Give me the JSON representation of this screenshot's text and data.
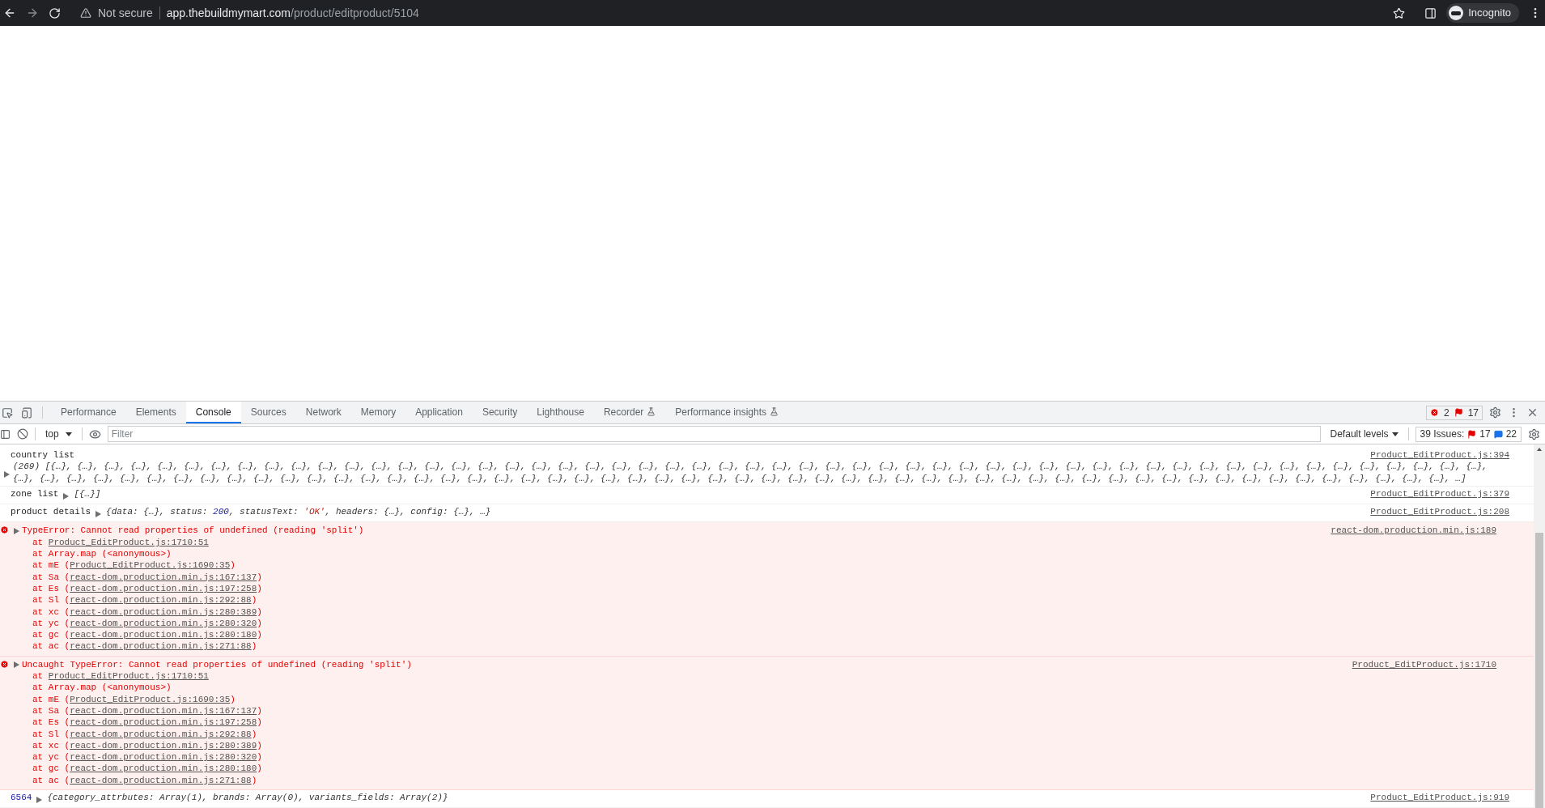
{
  "browser": {
    "security": "Not secure",
    "url_host": "app.thebuildmymart.com",
    "url_path": "/product/editproduct/5104",
    "profile": "Incognito"
  },
  "devtools": {
    "tabs": [
      {
        "label": "Performance",
        "selected": false,
        "experimental": false
      },
      {
        "label": "Elements",
        "selected": false,
        "experimental": false
      },
      {
        "label": "Console",
        "selected": true,
        "experimental": false
      },
      {
        "label": "Sources",
        "selected": false,
        "experimental": false
      },
      {
        "label": "Network",
        "selected": false,
        "experimental": false
      },
      {
        "label": "Memory",
        "selected": false,
        "experimental": false
      },
      {
        "label": "Application",
        "selected": false,
        "experimental": false
      },
      {
        "label": "Security",
        "selected": false,
        "experimental": false
      },
      {
        "label": "Lighthouse",
        "selected": false,
        "experimental": false
      },
      {
        "label": "Recorder",
        "selected": false,
        "experimental": true
      },
      {
        "label": "Performance insights",
        "selected": false,
        "experimental": true
      }
    ],
    "error_count": "2",
    "issue_count": "17",
    "context": "top",
    "filter_placeholder": "Filter",
    "levels": "Default levels",
    "issues": {
      "label": "39 Issues:",
      "errors": "17",
      "info": "22"
    }
  },
  "messages": [
    {
      "kind": "log",
      "label": "country list",
      "count": "(269)",
      "preview": [
        {
          "text": "[{…}, {…}, {…}, {…}, {…}, {…}, {…}, {…}, {…}, {…}, {…}, {…}, {…}, {…}, {…}, {…}, {…}, {…}, {…}, {…}, {…}, {…}, {…}, {…}, {…}, {…}, {…}, {…}, {…}, {…}, {…}, {…}, {…}, {…}, {…}, {…}, {…}, {…}, {…}, {…}, {…}, {…}, {…}, {…}, {…}, {…}, {…}, {…}, {…}, {…}, {…}, {…}, {…}, {…}, {…}, {…}, {…}, {…}, {…}, {…}, {…}, {…}, {…}, {…}, {…}, {…}, {…}, {…}, {…}, {…}, {…}, {…}, {…}, {…}, {…}, {…}, {…}, {…}, {…}, {…}, {…}, {…}, {…}, {…}, {…}, {…}, {…}, {…}, {…}, {…}, {…}, {…}, {…}, {…}, {…}, {…}, {…}, {…}, {…}, {…}, {…}, {…}, {…}, {…}, {…}, {…}, {…}, {…}, …]",
          "kind": "plain"
        }
      ],
      "source": "Product_EditProduct.js:394"
    },
    {
      "kind": "log",
      "label": "zone list",
      "preview": [
        {
          "text": "[{…}]",
          "kind": "plain"
        }
      ],
      "source": "Product_EditProduct.js:379"
    },
    {
      "kind": "log",
      "label": "product details",
      "preview": [
        {
          "text": "{data: {…}, status: ",
          "kind": "plain"
        },
        {
          "text": "200",
          "kind": "number"
        },
        {
          "text": ", statusText: ",
          "kind": "plain"
        },
        {
          "text": "'OK'",
          "kind": "string"
        },
        {
          "text": ", headers: {…}, config: {…}, …}",
          "kind": "plain"
        }
      ],
      "source": "Product_EditProduct.js:208"
    },
    {
      "kind": "error",
      "label": "TypeError: Cannot read properties of undefined (reading 'split')",
      "source": "react-dom.production.min.js:189",
      "stack": [
        [
          {
            "text": "at "
          },
          {
            "text": "Product_EditProduct.js:1710:51",
            "link": true
          }
        ],
        [
          {
            "text": "at Array.map (<anonymous>)"
          }
        ],
        [
          {
            "text": "at mE ("
          },
          {
            "text": "Product_EditProduct.js:1690:35",
            "link": true
          },
          {
            "text": ")"
          }
        ],
        [
          {
            "text": "at Sa ("
          },
          {
            "text": "react-dom.production.min.js:167:137",
            "link": true
          },
          {
            "text": ")"
          }
        ],
        [
          {
            "text": "at Es ("
          },
          {
            "text": "react-dom.production.min.js:197:258",
            "link": true
          },
          {
            "text": ")"
          }
        ],
        [
          {
            "text": "at Sl ("
          },
          {
            "text": "react-dom.production.min.js:292:88",
            "link": true
          },
          {
            "text": ")"
          }
        ],
        [
          {
            "text": "at xc ("
          },
          {
            "text": "react-dom.production.min.js:280:389",
            "link": true
          },
          {
            "text": ")"
          }
        ],
        [
          {
            "text": "at yc ("
          },
          {
            "text": "react-dom.production.min.js:280:320",
            "link": true
          },
          {
            "text": ")"
          }
        ],
        [
          {
            "text": "at gc ("
          },
          {
            "text": "react-dom.production.min.js:280:180",
            "link": true
          },
          {
            "text": ")"
          }
        ],
        [
          {
            "text": "at ac ("
          },
          {
            "text": "react-dom.production.min.js:271:88",
            "link": true
          },
          {
            "text": ")"
          }
        ]
      ]
    },
    {
      "kind": "error",
      "label": "Uncaught TypeError: Cannot read properties of undefined (reading 'split')",
      "source": "Product_EditProduct.js:1710",
      "stack": [
        [
          {
            "text": "at "
          },
          {
            "text": "Product_EditProduct.js:1710:51",
            "link": true
          }
        ],
        [
          {
            "text": "at Array.map (<anonymous>)"
          }
        ],
        [
          {
            "text": "at mE ("
          },
          {
            "text": "Product_EditProduct.js:1690:35",
            "link": true
          },
          {
            "text": ")"
          }
        ],
        [
          {
            "text": "at Sa ("
          },
          {
            "text": "react-dom.production.min.js:167:137",
            "link": true
          },
          {
            "text": ")"
          }
        ],
        [
          {
            "text": "at Es ("
          },
          {
            "text": "react-dom.production.min.js:197:258",
            "link": true
          },
          {
            "text": ")"
          }
        ],
        [
          {
            "text": "at Sl ("
          },
          {
            "text": "react-dom.production.min.js:292:88",
            "link": true
          },
          {
            "text": ")"
          }
        ],
        [
          {
            "text": "at xc ("
          },
          {
            "text": "react-dom.production.min.js:280:389",
            "link": true
          },
          {
            "text": ")"
          }
        ],
        [
          {
            "text": "at yc ("
          },
          {
            "text": "react-dom.production.min.js:280:320",
            "link": true
          },
          {
            "text": ")"
          }
        ],
        [
          {
            "text": "at gc ("
          },
          {
            "text": "react-dom.production.min.js:280:180",
            "link": true
          },
          {
            "text": ")"
          }
        ],
        [
          {
            "text": "at ac ("
          },
          {
            "text": "react-dom.production.min.js:271:88",
            "link": true
          },
          {
            "text": ")"
          }
        ]
      ]
    },
    {
      "kind": "log",
      "prefix": "6564",
      "preview": [
        {
          "text": "{category_attrbutes: Array(1), brands: Array(0), variants_fields: Array(2)}",
          "kind": "plain"
        }
      ],
      "source": "Product_EditProduct.js:919"
    }
  ]
}
